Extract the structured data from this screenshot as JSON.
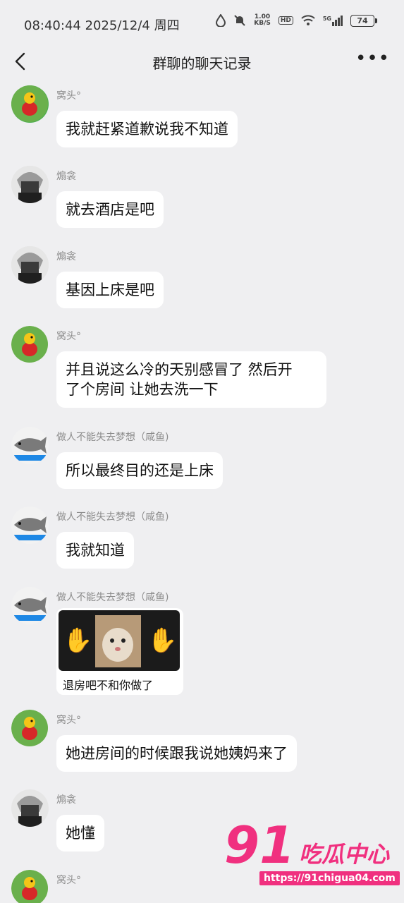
{
  "status_bar": {
    "time": "08:40:44 2025/12/4 周四",
    "net_speed_value": "1.00",
    "net_speed_unit": "KB/S",
    "hd": "HD",
    "signal_label": "5G",
    "battery": "74"
  },
  "header": {
    "title": "群聊的聊天记录"
  },
  "messages": [
    {
      "sender": "窝头°",
      "text": "我就赶紧道歉说我不知道"
    },
    {
      "sender": "煽衾",
      "text": "就去酒店是吧"
    },
    {
      "sender": "煽衾",
      "text": "基因上床是吧"
    },
    {
      "sender": "窝头°",
      "text_line1": "并且说这么冷的天别感冒了 然后开",
      "text_line2": "了个房间 让她去洗一下"
    },
    {
      "sender": "做人不能失去梦想（咸鱼)",
      "text": "所以最终目的还是上床"
    },
    {
      "sender": "做人不能失去梦想（咸鱼)",
      "text": "我就知道"
    },
    {
      "sender": "做人不能失去梦想（咸鱼)",
      "image_caption": "退房吧不和你做了"
    },
    {
      "sender": "窝头°",
      "text": "她进房间的时候跟我说她姨妈来了"
    },
    {
      "sender": "煽衾",
      "text": "她懂"
    },
    {
      "sender": "窝头°"
    }
  ],
  "watermark": {
    "big": "91",
    "brand": "吃瓜中心",
    "url": "https://91chigua04.com"
  },
  "icons": {
    "back": "chevron-left-icon",
    "more": "more-dots-icon",
    "status": [
      "water-drop-icon",
      "bell-off-icon",
      "wifi-icon",
      "signal-icon",
      "battery-icon"
    ]
  }
}
